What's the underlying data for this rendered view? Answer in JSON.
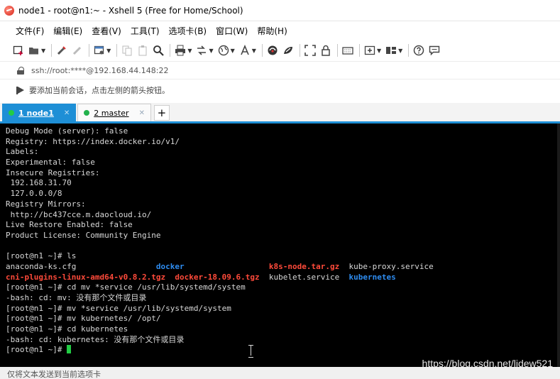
{
  "window": {
    "title": "node1 - root@n1:~ - Xshell 5 (Free for Home/School)"
  },
  "menu": [
    {
      "label": "文件(F)"
    },
    {
      "label": "编辑(E)"
    },
    {
      "label": "查看(V)"
    },
    {
      "label": "工具(T)"
    },
    {
      "label": "选项卡(B)"
    },
    {
      "label": "窗口(W)"
    },
    {
      "label": "帮助(H)"
    }
  ],
  "toolbar": {
    "icons": [
      "new-session-icon",
      "open-folder-icon",
      "reconnect-icon",
      "disconnect-icon",
      "properties-icon",
      "copy-icon",
      "paste-icon",
      "find-icon",
      "print-icon",
      "transfer-icon",
      "globe-icon",
      "font-icon",
      "xftp-icon",
      "xagent-icon",
      "fullscreen-icon",
      "lock-icon",
      "keyboard-icon",
      "add-tab-icon",
      "layout-icon",
      "help-icon",
      "chat-icon"
    ]
  },
  "address": {
    "text": "ssh://root:****@192.168.44.148:22"
  },
  "hint": {
    "text": "要添加当前会话，点击左侧的箭头按钮。"
  },
  "tabs": [
    {
      "label": "1 node1",
      "active": true
    },
    {
      "label": "2 master",
      "active": false
    }
  ],
  "terminal": {
    "lines": [
      [
        {
          "t": "Debug Mode (server): false"
        }
      ],
      [
        {
          "t": "Registry: https://index.docker.io/v1/"
        }
      ],
      [
        {
          "t": "Labels:"
        }
      ],
      [
        {
          "t": "Experimental: false"
        }
      ],
      [
        {
          "t": "Insecure Registries:"
        }
      ],
      [
        {
          "t": " 192.168.31.70"
        }
      ],
      [
        {
          "t": " 127.0.0.0/8"
        }
      ],
      [
        {
          "t": "Registry Mirrors:"
        }
      ],
      [
        {
          "t": " http://bc437cce.m.daocloud.io/"
        }
      ],
      [
        {
          "t": "Live Restore Enabled: false"
        }
      ],
      [
        {
          "t": "Product License: Community Engine"
        }
      ],
      [
        {
          "t": ""
        }
      ],
      [
        {
          "t": "[root@n1 ~]# ls"
        }
      ],
      [
        {
          "t": "anaconda-ks.cfg                 "
        },
        {
          "t": "docker",
          "c": "blue"
        },
        {
          "t": "                  "
        },
        {
          "t": "k8s-node.tar.gz",
          "c": "red"
        },
        {
          "t": "  kube-proxy.service"
        }
      ],
      [
        {
          "t": "cni-plugins-linux-amd64-v0.8.2.tgz",
          "c": "red"
        },
        {
          "t": "  "
        },
        {
          "t": "docker-18.09.6.tgz",
          "c": "red"
        },
        {
          "t": "  kubelet.service  "
        },
        {
          "t": "kubernetes",
          "c": "blue"
        }
      ],
      [
        {
          "t": "[root@n1 ~]# cd mv *service /usr/lib/systemd/system"
        }
      ],
      [
        {
          "t": "-bash: cd: mv: 没有那个文件或目录"
        }
      ],
      [
        {
          "t": "[root@n1 ~]# mv *service /usr/lib/systemd/system"
        }
      ],
      [
        {
          "t": "[root@n1 ~]# mv kubernetes/ /opt/"
        }
      ],
      [
        {
          "t": "[root@n1 ~]# cd kubernetes"
        }
      ],
      [
        {
          "t": "-bash: cd: kubernetes: 没有那个文件或目录"
        }
      ],
      [
        {
          "t": "[root@n1 ~]# "
        },
        {
          "cursor": true
        }
      ]
    ]
  },
  "watermark": "https://blog.csdn.net/lidew521",
  "status": {
    "text": "仅将文本发送到当前选项卡"
  },
  "colors": {
    "tab_active": "#1e8fd6",
    "terminal_bg": "#000000",
    "dir_blue": "#2e8cf0",
    "archive_red": "#ff4a3a",
    "cursor_green": "#22cc44"
  }
}
